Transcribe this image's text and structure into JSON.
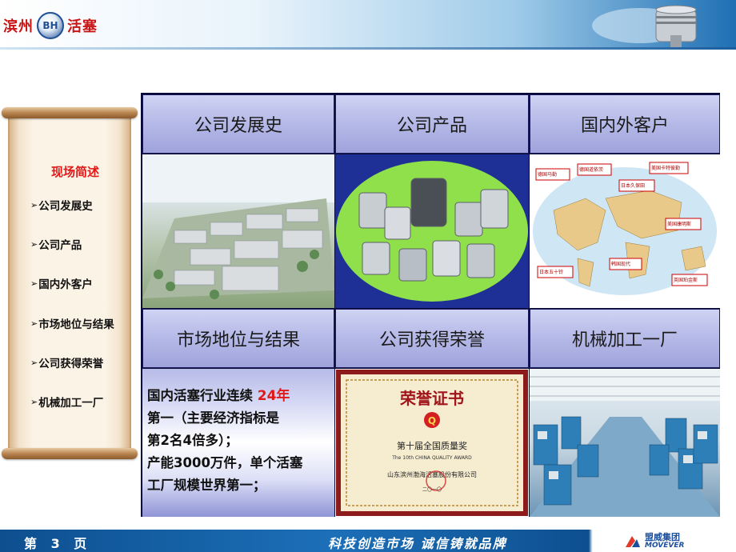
{
  "header": {
    "logo_left": "滨州",
    "logo_badge": "BH",
    "logo_right": "活塞"
  },
  "sidebar": {
    "title": "现场简述",
    "items": [
      {
        "label": "公司发展史"
      },
      {
        "label": "公司产品"
      },
      {
        "label": "国内外客户"
      },
      {
        "label": "市场地位与结果"
      },
      {
        "label": "公司获得荣誉"
      },
      {
        "label": "机械加工一厂"
      }
    ],
    "bullet": "➢"
  },
  "grid": {
    "row1_labels": [
      "公司发展史",
      "公司产品",
      "国内外客户"
    ],
    "row2_labels": [
      "市场地位与结果",
      "公司获得荣誉",
      "机械加工一厂"
    ],
    "market_text": {
      "line1_pre": "国内活塞行业连续 ",
      "line1_highlight": "24年",
      "line2": "第一（主要经济指标是",
      "line3": "第2名4倍多）；",
      "line4": " 产能3000万件，单个活塞",
      "line5": "工厂规模世界第一；"
    },
    "certificate": {
      "title": "荣誉证书",
      "award": "第十届全国质量奖",
      "award_en": "The 10th CHINA QUALITY AWARD",
      "company": "山东滨州渤海活塞股份有限公司",
      "date": "二〇一〇"
    },
    "map_labels": [
      "德国马勒",
      "德国道依茨",
      "美国卡特彼勒",
      "日本久保田",
      "美国康明斯",
      "韩国现代",
      "日本五十铃",
      "英国珀金斯"
    ]
  },
  "footer": {
    "page": "第 3 页",
    "slogan": "科技创造市场  诚信铸就品牌",
    "brand_cn": "盟威集团",
    "brand_en": "MOVEVER"
  },
  "colors": {
    "accent_red": "#e01818",
    "grid_border": "#0b0b3a",
    "footer_blue": "#0d4f8f"
  }
}
